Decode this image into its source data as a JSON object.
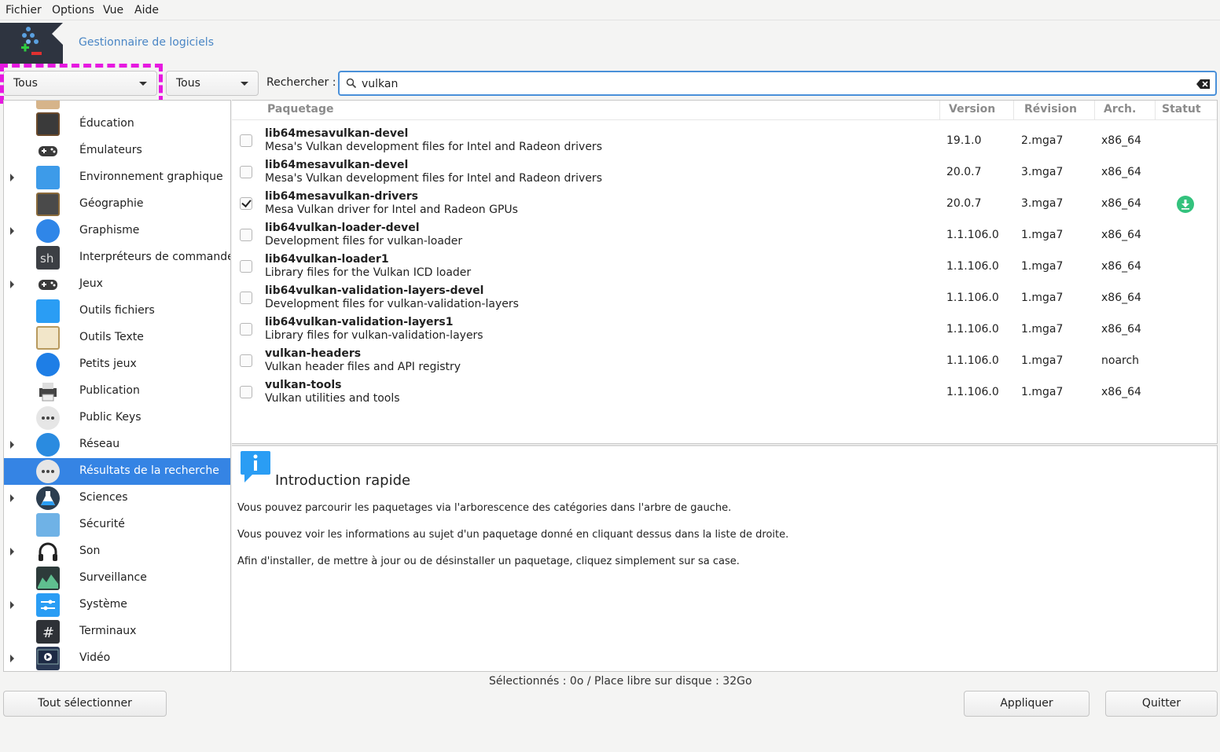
{
  "menu": {
    "file": "Fichier",
    "options": "Options",
    "view": "Vue",
    "help": "Aide"
  },
  "app": {
    "title": "Gestionnaire de logiciels"
  },
  "toolbar": {
    "filter1": "Tous",
    "filter2": "Tous",
    "search_label": "Rechercher :",
    "search_value": "vulkan"
  },
  "categories": [
    {
      "label": "Éducation",
      "expandable": false,
      "icon": "education-icon"
    },
    {
      "label": "Émulateurs",
      "expandable": false,
      "icon": "gamepad-icon"
    },
    {
      "label": "Environnement graphique",
      "expandable": true,
      "icon": "desktop-icon"
    },
    {
      "label": "Géographie",
      "expandable": false,
      "icon": "globe-icon"
    },
    {
      "label": "Graphisme",
      "expandable": true,
      "icon": "graphics-icon"
    },
    {
      "label": "Interpréteurs de commandes",
      "expandable": false,
      "icon": "shell-icon"
    },
    {
      "label": "Jeux",
      "expandable": true,
      "icon": "gamepad-icon"
    },
    {
      "label": "Outils fichiers",
      "expandable": false,
      "icon": "file-tools-icon"
    },
    {
      "label": "Outils Texte",
      "expandable": false,
      "icon": "text-tools-icon"
    },
    {
      "label": "Petits jeux",
      "expandable": false,
      "icon": "small-games-icon"
    },
    {
      "label": "Publication",
      "expandable": false,
      "icon": "printer-icon"
    },
    {
      "label": "Public Keys",
      "expandable": false,
      "icon": "more-icon"
    },
    {
      "label": "Réseau",
      "expandable": true,
      "icon": "network-icon"
    },
    {
      "label": "Résultats de la recherche",
      "expandable": false,
      "icon": "more-icon",
      "selected": true
    },
    {
      "label": "Sciences",
      "expandable": true,
      "icon": "science-icon"
    },
    {
      "label": "Sécurité",
      "expandable": false,
      "icon": "lock-icon"
    },
    {
      "label": "Son",
      "expandable": true,
      "icon": "headphones-icon"
    },
    {
      "label": "Surveillance",
      "expandable": false,
      "icon": "monitor-chart-icon"
    },
    {
      "label": "Système",
      "expandable": true,
      "icon": "system-settings-icon"
    },
    {
      "label": "Terminaux",
      "expandable": false,
      "icon": "terminal-icon"
    },
    {
      "label": "Vidéo",
      "expandable": true,
      "icon": "video-icon"
    }
  ],
  "columns": {
    "package": "Paquetage",
    "version": "Version",
    "revision": "Révision",
    "arch": "Arch.",
    "status": "Statut"
  },
  "packages": [
    {
      "name": "lib64mesavulkan-devel",
      "desc": "Mesa's Vulkan development files for Intel and Radeon drivers",
      "version": "19.1.0",
      "revision": "2.mga7",
      "arch": "x86_64",
      "checked": false,
      "status": ""
    },
    {
      "name": "lib64mesavulkan-devel",
      "desc": "Mesa's Vulkan development files for Intel and Radeon drivers",
      "version": "20.0.7",
      "revision": "3.mga7",
      "arch": "x86_64",
      "checked": false,
      "status": ""
    },
    {
      "name": "lib64mesavulkan-drivers",
      "desc": "Mesa Vulkan driver for Intel and Radeon GPUs",
      "version": "20.0.7",
      "revision": "3.mga7",
      "arch": "x86_64",
      "checked": true,
      "status": "download-icon"
    },
    {
      "name": "lib64vulkan-loader-devel",
      "desc": "Development files for vulkan-loader",
      "version": "1.1.106.0",
      "revision": "1.mga7",
      "arch": "x86_64",
      "checked": false,
      "status": ""
    },
    {
      "name": "lib64vulkan-loader1",
      "desc": "Library files for the Vulkan ICD loader",
      "version": "1.1.106.0",
      "revision": "1.mga7",
      "arch": "x86_64",
      "checked": false,
      "status": ""
    },
    {
      "name": "lib64vulkan-validation-layers-devel",
      "desc": "Development files for vulkan-validation-layers",
      "version": "1.1.106.0",
      "revision": "1.mga7",
      "arch": "x86_64",
      "checked": false,
      "status": ""
    },
    {
      "name": "lib64vulkan-validation-layers1",
      "desc": "Library files for vulkan-validation-layers",
      "version": "1.1.106.0",
      "revision": "1.mga7",
      "arch": "x86_64",
      "checked": false,
      "status": ""
    },
    {
      "name": "vulkan-headers",
      "desc": "Vulkan header files and API registry",
      "version": "1.1.106.0",
      "revision": "1.mga7",
      "arch": "noarch",
      "checked": false,
      "status": ""
    },
    {
      "name": "vulkan-tools",
      "desc": "Vulkan utilities and tools",
      "version": "1.1.106.0",
      "revision": "1.mga7",
      "arch": "x86_64",
      "checked": false,
      "status": ""
    }
  ],
  "info": {
    "title": "Introduction rapide",
    "p1": "Vous pouvez parcourir les paquetages via l'arborescence des catégories dans l'arbre de gauche.",
    "p2": "Vous pouvez voir les informations au sujet d'un paquetage donné en cliquant dessus dans la liste de droite.",
    "p3": "Afin d'installer, de mettre à jour ou de désinstaller un paquetage, cliquez simplement sur sa case."
  },
  "status_line": "Sélectionnés : 0o / Place libre sur disque : 32Go",
  "buttons": {
    "select_all": "Tout sélectionner",
    "apply": "Appliquer",
    "quit": "Quitter"
  },
  "colors": {
    "accent": "#3584e4",
    "highlight": "#e619e0",
    "status_green": "#33c27d"
  }
}
